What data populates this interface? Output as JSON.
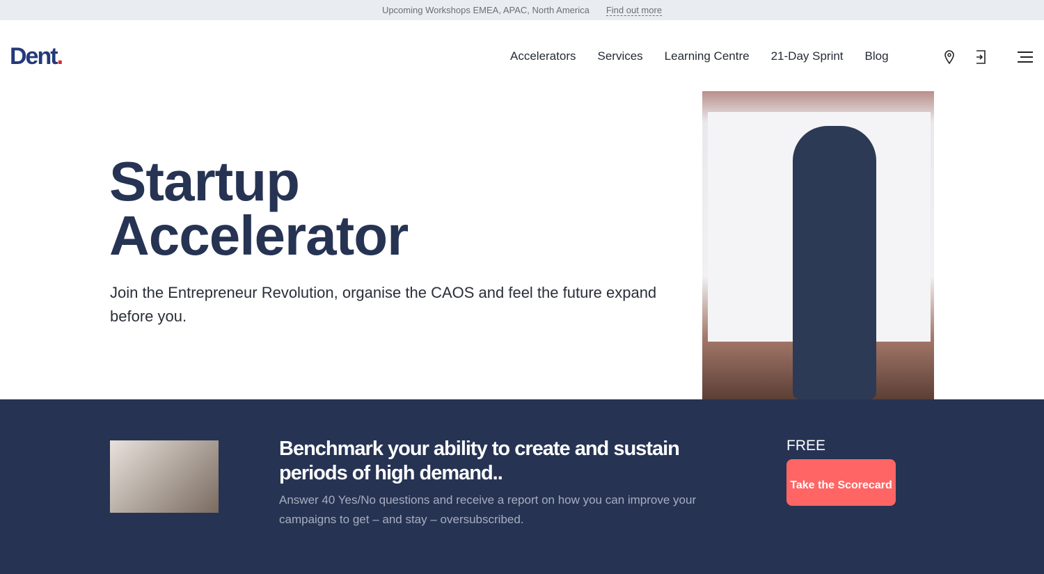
{
  "announcement": {
    "text": "Upcoming Workshops EMEA, APAC, North America",
    "link": "Find out more"
  },
  "nav": {
    "logo": "Dent",
    "logo_dot": ".",
    "items": [
      "Accelerators",
      "Services",
      "Learning Centre",
      "21-Day Sprint",
      "Blog"
    ],
    "icons": [
      "location-pin-icon",
      "login-icon",
      "menu-icon"
    ]
  },
  "hero": {
    "title_line1": "Startup",
    "title_line2": "Accelerator",
    "subtitle": "Join the Entrepreneur Revolution, organise the CAOS and feel the future expand before you."
  },
  "promo": {
    "heading": "Benchmark your ability to create and sustain periods of high demand..",
    "body": "Answer 40 Yes/No questions and receive a report on how you can improve your campaigns to get – and stay – oversubscribed.",
    "free_label": "FREE",
    "cta": "Take the Scorecard"
  },
  "colors": {
    "navy": "#263353",
    "cta": "#fe6564",
    "logo": "#233a7a"
  }
}
